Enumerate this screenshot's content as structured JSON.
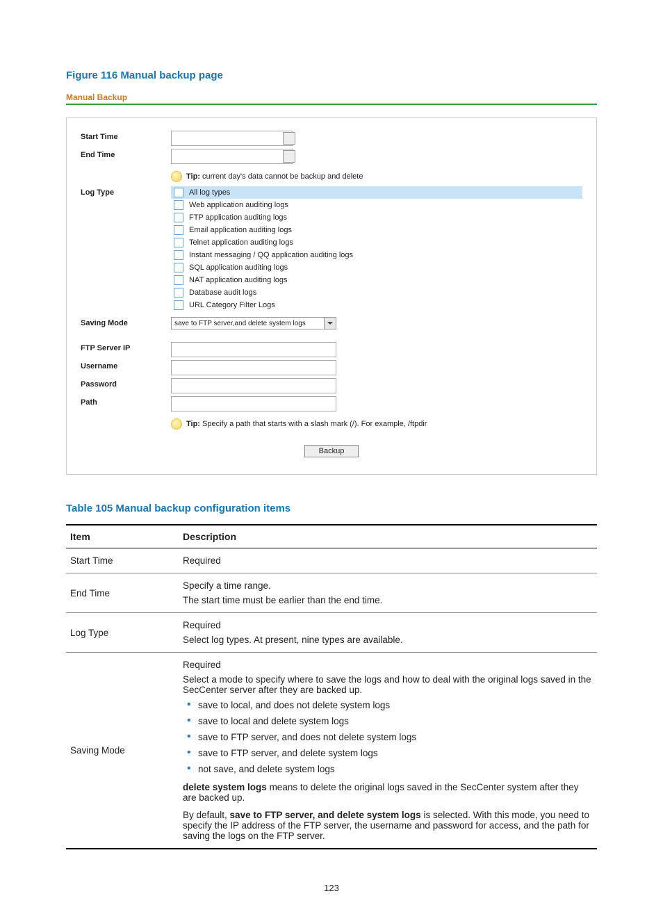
{
  "figure": {
    "title": "Figure 116 Manual backup page"
  },
  "panel": {
    "heading": "Manual Backup",
    "labels": {
      "startTime": "Start Time",
      "endTime": "End Time",
      "logType": "Log Type",
      "savingMode": "Saving Mode",
      "ftpServerIp": "FTP Server IP",
      "username": "Username",
      "password": "Password",
      "path": "Path"
    },
    "tips": {
      "tipWord": "Tip:",
      "time": " current day's data cannot be backup and delete",
      "path": " Specify a path that starts with a slash mark (/). For example, /ftpdir"
    },
    "logTypes": [
      "All log types",
      "Web application auditing logs",
      "FTP application auditing logs",
      "Email application auditing logs",
      "Telnet application auditing logs",
      "Instant messaging / QQ application auditing logs",
      "SQL application auditing logs",
      "NAT application auditing logs",
      "Database audit logs",
      "URL Category Filter Logs"
    ],
    "savingModeSelected": "save to FTP server,and delete system logs",
    "button": "Backup"
  },
  "table": {
    "title": "Table 105 Manual backup configuration items",
    "headers": {
      "item": "Item",
      "description": "Description"
    },
    "rows": {
      "r1": {
        "item": "Start Time",
        "desc": "Required"
      },
      "r2": {
        "item": "End Time",
        "l1": "Specify a time range.",
        "l2": "The start time must be earlier than the end time."
      },
      "r3": {
        "item": "Log Type",
        "l1": "Required",
        "l2": "Select log types. At present, nine types are available."
      },
      "r4": {
        "item": "Saving Mode",
        "l1": "Required",
        "l2": "Select a mode to specify where to save the logs and how to deal with the original logs saved in the SecCenter server after they are backed up.",
        "bullets": [
          "save to local, and does not delete system logs",
          "save to local and delete system logs",
          "save to FTP server, and does not delete system logs",
          "save to FTP server, and delete system logs",
          "not save, and delete system logs"
        ],
        "boldA": "delete system logs",
        "afterA": " means to delete the original logs saved in the SecCenter system after they are backed up.",
        "pre5": "By default, ",
        "boldB": "save to FTP server, and delete system logs",
        "afterB": " is selected. With this mode, you need to specify the IP address of the FTP server, the username and password for access, and the path for saving the logs on the FTP server."
      }
    }
  },
  "pageNumber": "123"
}
